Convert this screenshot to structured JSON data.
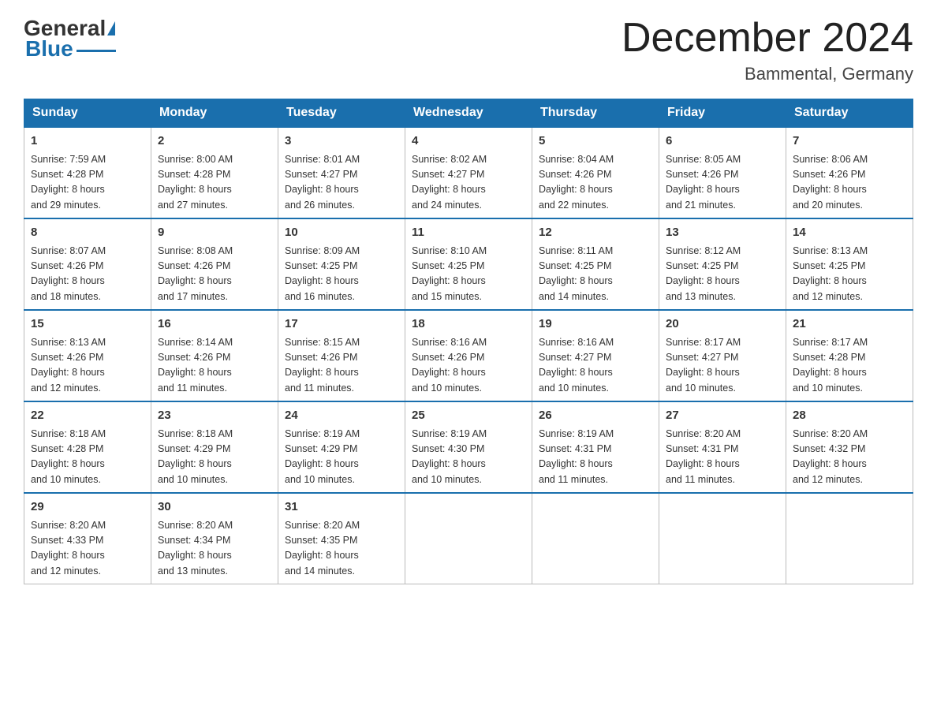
{
  "header": {
    "logo_general": "General",
    "logo_blue": "Blue",
    "month_title": "December 2024",
    "location": "Bammental, Germany"
  },
  "days_of_week": [
    "Sunday",
    "Monday",
    "Tuesday",
    "Wednesday",
    "Thursday",
    "Friday",
    "Saturday"
  ],
  "weeks": [
    [
      {
        "day": "1",
        "sunrise": "7:59 AM",
        "sunset": "4:28 PM",
        "daylight": "8 hours and 29 minutes."
      },
      {
        "day": "2",
        "sunrise": "8:00 AM",
        "sunset": "4:28 PM",
        "daylight": "8 hours and 27 minutes."
      },
      {
        "day": "3",
        "sunrise": "8:01 AM",
        "sunset": "4:27 PM",
        "daylight": "8 hours and 26 minutes."
      },
      {
        "day": "4",
        "sunrise": "8:02 AM",
        "sunset": "4:27 PM",
        "daylight": "8 hours and 24 minutes."
      },
      {
        "day": "5",
        "sunrise": "8:04 AM",
        "sunset": "4:26 PM",
        "daylight": "8 hours and 22 minutes."
      },
      {
        "day": "6",
        "sunrise": "8:05 AM",
        "sunset": "4:26 PM",
        "daylight": "8 hours and 21 minutes."
      },
      {
        "day": "7",
        "sunrise": "8:06 AM",
        "sunset": "4:26 PM",
        "daylight": "8 hours and 20 minutes."
      }
    ],
    [
      {
        "day": "8",
        "sunrise": "8:07 AM",
        "sunset": "4:26 PM",
        "daylight": "8 hours and 18 minutes."
      },
      {
        "day": "9",
        "sunrise": "8:08 AM",
        "sunset": "4:26 PM",
        "daylight": "8 hours and 17 minutes."
      },
      {
        "day": "10",
        "sunrise": "8:09 AM",
        "sunset": "4:25 PM",
        "daylight": "8 hours and 16 minutes."
      },
      {
        "day": "11",
        "sunrise": "8:10 AM",
        "sunset": "4:25 PM",
        "daylight": "8 hours and 15 minutes."
      },
      {
        "day": "12",
        "sunrise": "8:11 AM",
        "sunset": "4:25 PM",
        "daylight": "8 hours and 14 minutes."
      },
      {
        "day": "13",
        "sunrise": "8:12 AM",
        "sunset": "4:25 PM",
        "daylight": "8 hours and 13 minutes."
      },
      {
        "day": "14",
        "sunrise": "8:13 AM",
        "sunset": "4:25 PM",
        "daylight": "8 hours and 12 minutes."
      }
    ],
    [
      {
        "day": "15",
        "sunrise": "8:13 AM",
        "sunset": "4:26 PM",
        "daylight": "8 hours and 12 minutes."
      },
      {
        "day": "16",
        "sunrise": "8:14 AM",
        "sunset": "4:26 PM",
        "daylight": "8 hours and 11 minutes."
      },
      {
        "day": "17",
        "sunrise": "8:15 AM",
        "sunset": "4:26 PM",
        "daylight": "8 hours and 11 minutes."
      },
      {
        "day": "18",
        "sunrise": "8:16 AM",
        "sunset": "4:26 PM",
        "daylight": "8 hours and 10 minutes."
      },
      {
        "day": "19",
        "sunrise": "8:16 AM",
        "sunset": "4:27 PM",
        "daylight": "8 hours and 10 minutes."
      },
      {
        "day": "20",
        "sunrise": "8:17 AM",
        "sunset": "4:27 PM",
        "daylight": "8 hours and 10 minutes."
      },
      {
        "day": "21",
        "sunrise": "8:17 AM",
        "sunset": "4:28 PM",
        "daylight": "8 hours and 10 minutes."
      }
    ],
    [
      {
        "day": "22",
        "sunrise": "8:18 AM",
        "sunset": "4:28 PM",
        "daylight": "8 hours and 10 minutes."
      },
      {
        "day": "23",
        "sunrise": "8:18 AM",
        "sunset": "4:29 PM",
        "daylight": "8 hours and 10 minutes."
      },
      {
        "day": "24",
        "sunrise": "8:19 AM",
        "sunset": "4:29 PM",
        "daylight": "8 hours and 10 minutes."
      },
      {
        "day": "25",
        "sunrise": "8:19 AM",
        "sunset": "4:30 PM",
        "daylight": "8 hours and 10 minutes."
      },
      {
        "day": "26",
        "sunrise": "8:19 AM",
        "sunset": "4:31 PM",
        "daylight": "8 hours and 11 minutes."
      },
      {
        "day": "27",
        "sunrise": "8:20 AM",
        "sunset": "4:31 PM",
        "daylight": "8 hours and 11 minutes."
      },
      {
        "day": "28",
        "sunrise": "8:20 AM",
        "sunset": "4:32 PM",
        "daylight": "8 hours and 12 minutes."
      }
    ],
    [
      {
        "day": "29",
        "sunrise": "8:20 AM",
        "sunset": "4:33 PM",
        "daylight": "8 hours and 12 minutes."
      },
      {
        "day": "30",
        "sunrise": "8:20 AM",
        "sunset": "4:34 PM",
        "daylight": "8 hours and 13 minutes."
      },
      {
        "day": "31",
        "sunrise": "8:20 AM",
        "sunset": "4:35 PM",
        "daylight": "8 hours and 14 minutes."
      },
      null,
      null,
      null,
      null
    ]
  ],
  "labels": {
    "sunrise_prefix": "Sunrise: ",
    "sunset_prefix": "Sunset: ",
    "daylight_prefix": "Daylight: "
  }
}
